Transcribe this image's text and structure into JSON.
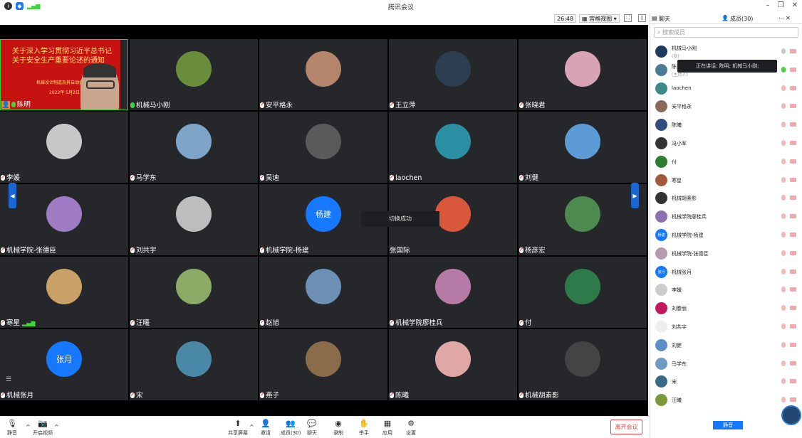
{
  "title": "腾讯会议",
  "toolbar": {
    "timer": "26:48",
    "view_label": "宫格视图"
  },
  "panel": {
    "tab_chat": "聊天",
    "tab_members": "成员(30)",
    "search_placeholder": "搜索成员",
    "mute_all": "静音",
    "tooltip": "正在讲话: 陈明; 机械马小刚;"
  },
  "tiles": [
    {
      "name": "陈明",
      "speaker": true
    },
    {
      "name": "机械马小刚",
      "mic": "green"
    },
    {
      "name": "安平格永"
    },
    {
      "name": "王立萍"
    },
    {
      "name": "张晓君"
    },
    {
      "name": "李媛"
    },
    {
      "name": "马学东"
    },
    {
      "name": "吴迪"
    },
    {
      "name": "laochen"
    },
    {
      "name": "刘健"
    },
    {
      "name": "机械学院-张德臣"
    },
    {
      "name": "刘共宇"
    },
    {
      "name": "机械学院-杨建",
      "text_avatar": "杨建"
    },
    {
      "name": "张国际",
      "nomic": true
    },
    {
      "name": "杨彦宏"
    },
    {
      "name": "寒星",
      "signal": true
    },
    {
      "name": "汪曦"
    },
    {
      "name": "赵旭"
    },
    {
      "name": "机械学院廖桂兵"
    },
    {
      "name": "付"
    },
    {
      "name": "机械张月",
      "text_avatar": "张月"
    },
    {
      "name": "宋"
    },
    {
      "name": "燕子"
    },
    {
      "name": "陈曦"
    },
    {
      "name": "机械胡素影"
    }
  ],
  "speaker_banner": {
    "line1": "关于深入学习贯彻习近平总书记",
    "line2": "关于安全生产重要论述的通知",
    "line3": "机械设计制造及其自动化",
    "line4": "2022年 5月2日"
  },
  "toast": "切换成功",
  "members": [
    {
      "name": "机械马小刚",
      "role": "(我)"
    },
    {
      "name": "陈",
      "role": "(主持人)"
    },
    {
      "name": "laochen"
    },
    {
      "name": "安平格永"
    },
    {
      "name": "陈曦"
    },
    {
      "name": "冯小军"
    },
    {
      "name": "付"
    },
    {
      "name": "寒星"
    },
    {
      "name": "机械胡素影"
    },
    {
      "name": "机械学院廖桂兵"
    },
    {
      "name": "机械学院-杨建",
      "text_avatar": "杨建"
    },
    {
      "name": "机械学院-张德臣"
    },
    {
      "name": "机械张月",
      "text_avatar": "张月"
    },
    {
      "name": "李媛"
    },
    {
      "name": "刘春丽"
    },
    {
      "name": "刘共宇"
    },
    {
      "name": "刘健"
    },
    {
      "name": "马学东"
    },
    {
      "name": "宋"
    },
    {
      "name": "汪曦"
    }
  ],
  "bottom": {
    "mute": "静音",
    "video": "开启视频",
    "share": "共享屏幕",
    "invite": "邀请",
    "members": "成员(30)",
    "chat": "聊天",
    "record": "录制",
    "raise": "举手",
    "apps": "应用",
    "settings": "设置",
    "leave": "离开会议"
  },
  "colors": {
    "accent": "#1677ff",
    "tile_bg": "#25272b",
    "speaking": "#2bd12b",
    "danger": "#e44444"
  }
}
